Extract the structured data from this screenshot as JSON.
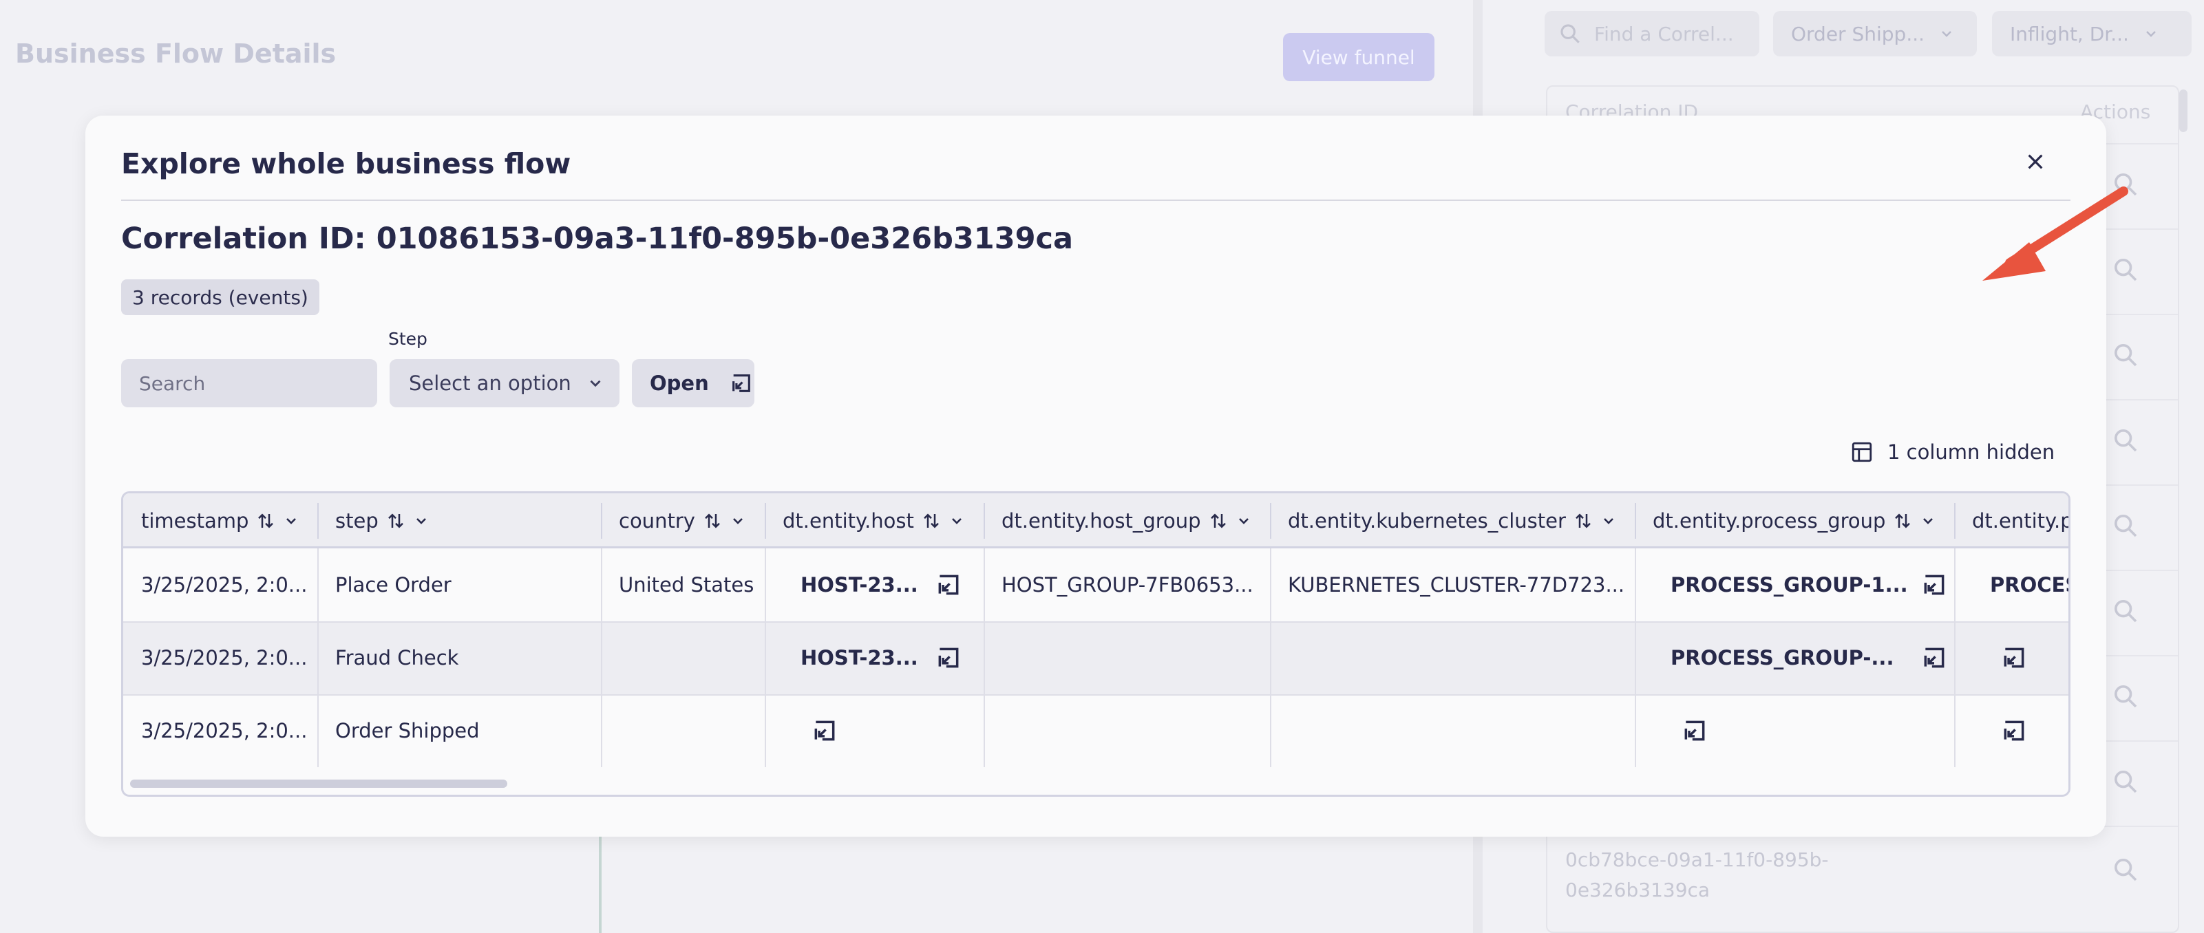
{
  "background": {
    "page_title": "Business Flow Details",
    "view_funnel_label": "View funnel",
    "search_placeholder": "Find a Correl...",
    "filter_step": "Order Shipp...",
    "filter_status": "Inflight, Dr...",
    "table_header_corr": "Correlation ID",
    "table_header_actions": "Actions",
    "visible_corr_id": "0cb78bce-09a1-11f0-895b-0e326b3139ca"
  },
  "modal": {
    "title": "Explore whole business flow",
    "correlation_label": "Correlation ID: 01086153-09a3-11f0-895b-0e326b3139ca",
    "records_badge": "3 records (events)",
    "step_label": "Step",
    "search_placeholder": "Search",
    "select_placeholder": "Select an option",
    "open_label": "Open",
    "columns_hidden": "1 column hidden",
    "table": {
      "columns": [
        "timestamp",
        "step",
        "country",
        "dt.entity.host",
        "dt.entity.host_group",
        "dt.entity.kubernetes_cluster",
        "dt.entity.process_group",
        "dt.entity.p"
      ],
      "rows": [
        [
          "3/25/2025, 2:0...",
          "Place Order",
          "United States",
          "HOST-23...",
          "HOST_GROUP-7FB0653...",
          "KUBERNETES_CLUSTER-77D723...",
          "PROCESS_GROUP-1...",
          "PROCES"
        ],
        [
          "3/25/2025, 2:0...",
          "Fraud Check",
          "",
          "HOST-23...",
          "",
          "",
          "PROCESS_GROUP-...",
          ""
        ],
        [
          "3/25/2025, 2:0...",
          "Order Shipped",
          "",
          "",
          "",
          "",
          "",
          ""
        ]
      ]
    }
  },
  "colors": {
    "accent": "#cbcaf0",
    "text": "#27294a",
    "annotation_arrow": "#e8543e"
  }
}
